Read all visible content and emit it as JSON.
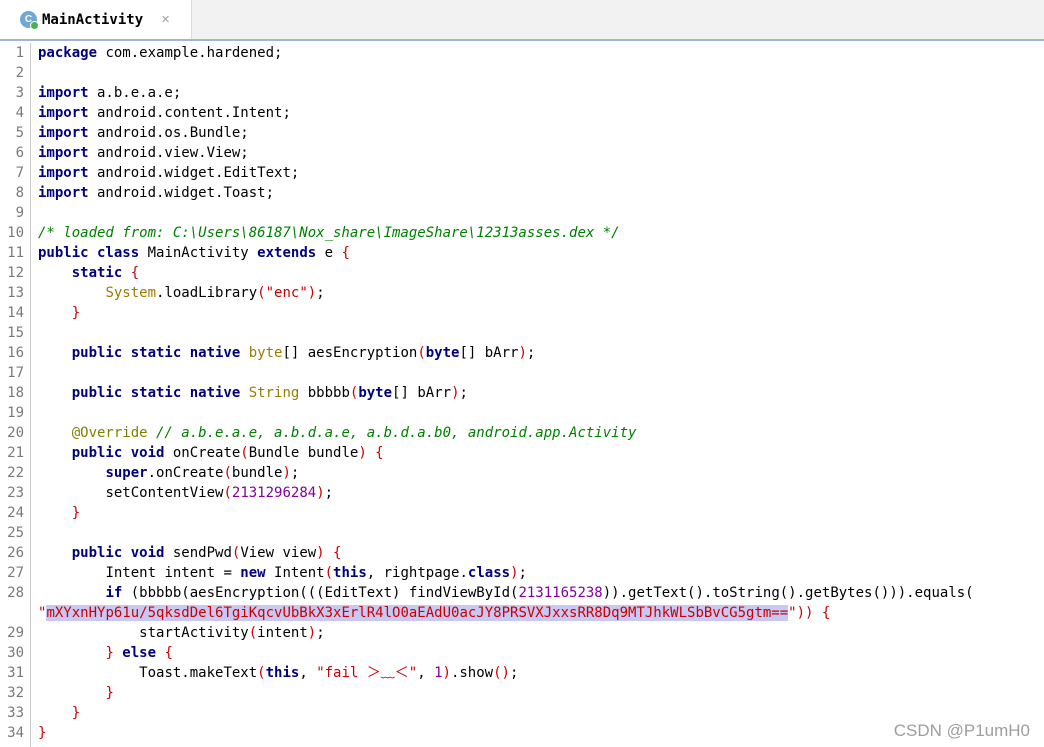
{
  "tab": {
    "title": "MainActivity",
    "icon_letter": "C",
    "close_glyph": "×"
  },
  "gutter": {
    "numbers": [
      "1",
      "2",
      "3",
      "4",
      "5",
      "6",
      "7",
      "8",
      "9",
      "10",
      "11",
      "12",
      "13",
      "14",
      "15",
      "16",
      "17",
      "18",
      "19",
      "20",
      "21",
      "22",
      "23",
      "24",
      "25",
      "26",
      "27",
      "28",
      "",
      "29",
      "30",
      "31",
      "32",
      "33",
      "34"
    ]
  },
  "code": {
    "l1_kw": "package",
    "l1_rest": " com.example.hardened;",
    "l3_kw": "import",
    "l3_rest": " a.b.e.a.e;",
    "l4_kw": "import",
    "l4_rest": " android.content.Intent;",
    "l5_kw": "import",
    "l5_rest": " android.os.Bundle;",
    "l6_kw": "import",
    "l6_rest": " android.view.View;",
    "l7_kw": "import",
    "l7_rest": " android.widget.EditText;",
    "l8_kw": "import",
    "l8_rest": " android.widget.Toast;",
    "l10_comment": "/* loaded from: C:\\Users\\86187\\Nox_share\\ImageShare\\12313asses.dex */",
    "l11_kw1": "public class",
    "l11_name": " MainActivity ",
    "l11_kw2": "extends",
    "l11_rest": " e ",
    "l11_brace": "{",
    "l12_kw": "static",
    "l12_brace": " {",
    "l13_sys": "System",
    "l13_call": ".loadLibrary",
    "l13_p1": "(",
    "l13_str": "\"enc\"",
    "l13_p2": ")",
    "l13_end": ";",
    "l14_brace": "}",
    "l16_kw": "public static native",
    "l16_type": " byte",
    "l16_mid": "[] aesEncryption",
    "l16_p1": "(",
    "l16_kw2": "byte",
    "l16_arg": "[] bArr",
    "l16_p2": ")",
    "l16_end": ";",
    "l18_kw": "public static native",
    "l18_type": " String",
    "l18_mid": " bbbbb",
    "l18_p1": "(",
    "l18_kw2": "byte",
    "l18_arg": "[] bArr",
    "l18_p2": ")",
    "l18_end": ";",
    "l20_ann": "@Override",
    "l20_comment": " // a.b.e.a.e, a.b.d.a.e, a.b.d.a.b0, android.app.Activity",
    "l21_kw": "public void",
    "l21_mid": " onCreate",
    "l21_p1": "(",
    "l21_arg": "Bundle bundle",
    "l21_p2": ")",
    "l21_brace": " {",
    "l22_kw": "super",
    "l22_mid": ".onCreate",
    "l22_p1": "(",
    "l22_arg": "bundle",
    "l22_p2": ")",
    "l22_end": ";",
    "l23_call": "setContentView",
    "l23_p1": "(",
    "l23_num": "2131296284",
    "l23_p2": ")",
    "l23_end": ";",
    "l24_brace": "}",
    "l26_kw": "public void",
    "l26_mid": " sendPwd",
    "l26_p1": "(",
    "l26_arg": "View view",
    "l26_p2": ")",
    "l26_brace": " {",
    "l27_a": "Intent intent = ",
    "l27_kw": "new",
    "l27_b": " Intent",
    "l27_p1": "(",
    "l27_kw2": "this",
    "l27_c": ", rightpage.",
    "l27_kw3": "class",
    "l27_p2": ")",
    "l27_end": ";",
    "l28_kw": "if",
    "l28_a": " (bbbbb(aesEncryption(((EditText) findViewById(",
    "l28_num": "2131165238",
    "l28_b": ")).getText().toString().getBytes())).equals(",
    "l28w_q1": "\"",
    "l28w_str": "mXYxnHYp61u/5qksdDel6TgiKqcvUbBkX3xErlR4lO0aEAdU0acJY8PRSVXJxxsRR8Dq9MTJhkWLSbBvCG5gtm==",
    "l28w_q2": "\"",
    "l28w_rest": ")) {",
    "l29_call": "startActivity",
    "l29_p1": "(",
    "l29_arg": "intent",
    "l29_p2": ")",
    "l29_end": ";",
    "l30_brace": "} ",
    "l30_kw": "else",
    "l30_brace2": " {",
    "l31_a": "Toast.makeText",
    "l31_p1": "(",
    "l31_kw": "this",
    "l31_b": ", ",
    "l31_str": "\"fail ＞﹏＜\"",
    "l31_c": ", ",
    "l31_num": "1",
    "l31_p2": ")",
    "l31_d": ".show",
    "l31_p3": "()",
    "l31_end": ";",
    "l32_brace": "}",
    "l33_brace": "}",
    "l34_brace": "}"
  },
  "watermark": "CSDN @P1umH0",
  "colors": {
    "keyword": "#000080",
    "comment": "#008000",
    "string": "#cc0000",
    "number": "#8000a0",
    "selection": "#c8c8f4"
  }
}
